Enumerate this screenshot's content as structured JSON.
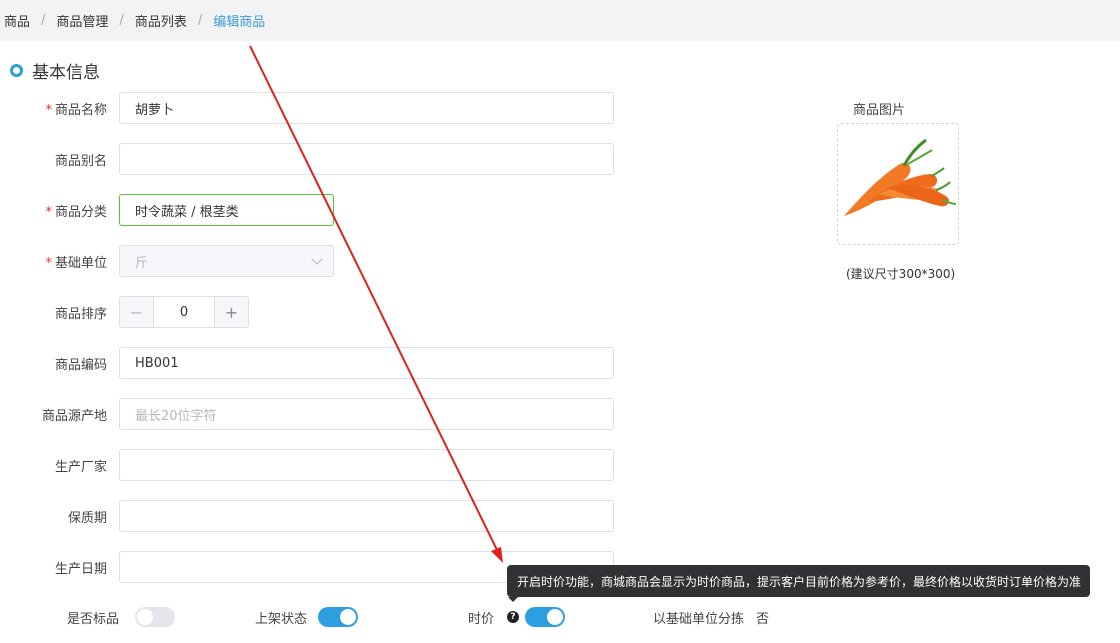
{
  "breadcrumb": [
    "商品",
    "商品管理",
    "商品列表",
    "编辑商品"
  ],
  "breadcrumb_separator": "/",
  "section_title": "基本信息",
  "form": {
    "name": {
      "label": "商品名称",
      "required": "*",
      "value": "胡萝卜"
    },
    "alias": {
      "label": "商品别名",
      "value": ""
    },
    "category": {
      "label": "商品分类",
      "required": "*",
      "value": "时令蔬菜 / 根茎类"
    },
    "unit": {
      "label": "基础单位",
      "required": "*",
      "value": "斤"
    },
    "sort": {
      "label": "商品排序",
      "value": "0",
      "minus": "−",
      "plus": "+"
    },
    "code": {
      "label": "商品编码",
      "value": "HB001"
    },
    "origin": {
      "label": "商品源产地",
      "placeholder": "最长20位字符"
    },
    "manufacturer": {
      "label": "生产厂家",
      "value": ""
    },
    "shelf_life": {
      "label": "保质期",
      "value": ""
    },
    "production_date": {
      "label": "生产日期",
      "value": ""
    }
  },
  "image": {
    "label": "商品图片",
    "hint": "(建议尺寸300*300)",
    "subject": "carrots"
  },
  "bottom": {
    "is_standard": {
      "label": "是否标品",
      "on": false
    },
    "listing_status": {
      "label": "上架状态",
      "on": true
    },
    "market_price": {
      "label": "时价",
      "help_icon": "?",
      "on": true
    },
    "sort_by_base_unit": {
      "label": "以基础单位分拣",
      "value": "否"
    }
  },
  "tooltip": "开启时价功能，商城商品会显示为时价商品，提示客户目前价格为参考价，最终价格以收货时订单价格为准",
  "colors": {
    "accent": "#2d9fe0",
    "required": "#e5312f",
    "focus_border": "#5bbf3d",
    "annotation_arrow": "#e0201c",
    "tooltip_bg": "#303133"
  }
}
